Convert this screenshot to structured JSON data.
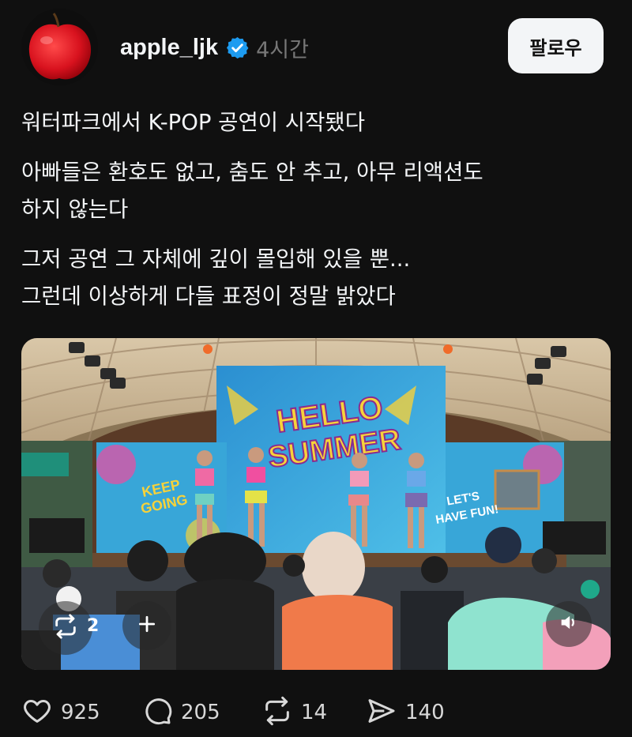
{
  "post": {
    "username": "apple_ljk",
    "verified": true,
    "time": "4시간",
    "follow_label": "팔로우",
    "paragraphs": [
      [
        "워터파크에서 K-POP 공연이 시작됐다"
      ],
      [
        "아빠들은 환호도 없고, 춤도 안 추고, 아무 리액션도",
        "하지 않는다"
      ],
      [
        "그저 공연 그 자체에 깊이 몰입해 있을 뿐...",
        "그런데 이상하게 다들 표정이 정말 밝았다"
      ]
    ]
  },
  "media": {
    "stage_banner": {
      "headline_1": "HELLO",
      "headline_2": "SUMMER",
      "left_panel_1": "KEEP",
      "left_panel_2": "GOING",
      "right_panel_1": "LET'S",
      "right_panel_2": "HAVE FUN!"
    },
    "repost_count": "2"
  },
  "actions": {
    "likes": "925",
    "comments": "205",
    "reposts": "14",
    "shares": "140"
  },
  "colors": {
    "background": "#101010",
    "verified": "#1d9bf0",
    "follow_button": "#f3f5f7"
  }
}
